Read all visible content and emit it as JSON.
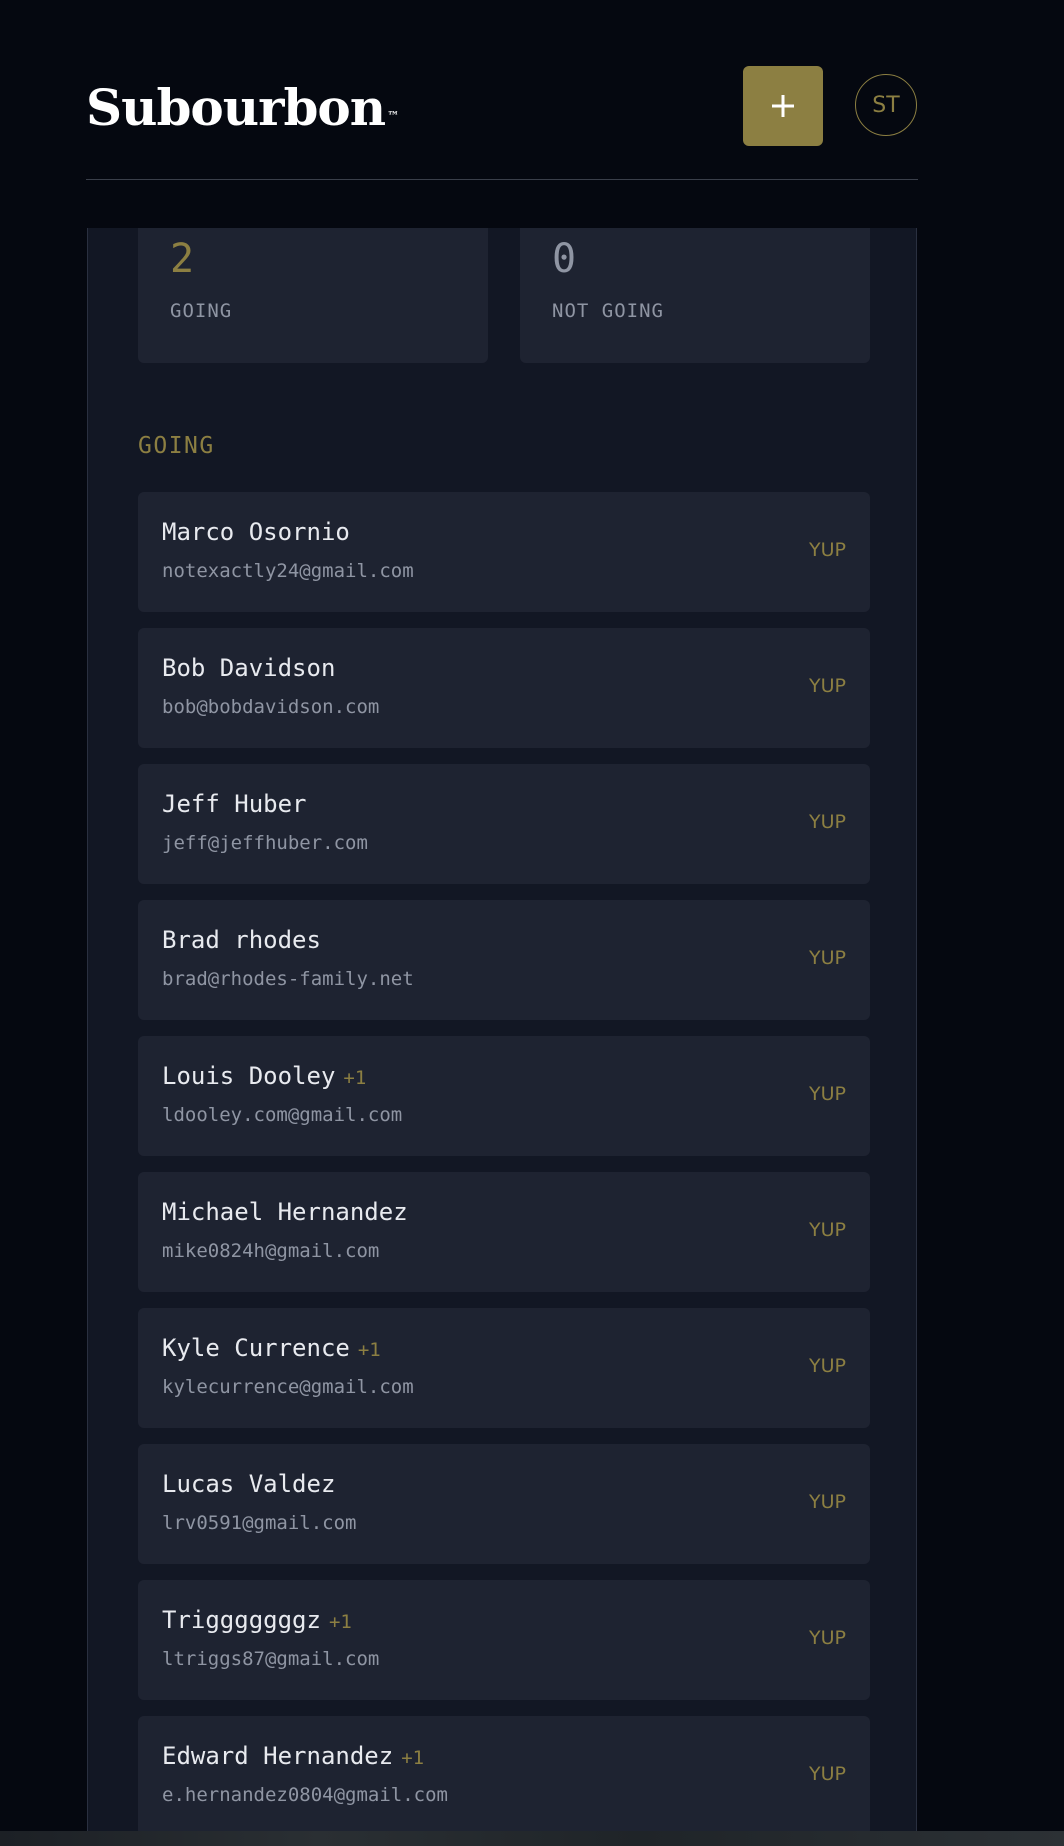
{
  "header": {
    "logo_text": "Subourbon",
    "logo_mark": "™",
    "add_button_icon": "plus-icon",
    "avatar_initials": "ST"
  },
  "stats": {
    "going": {
      "value": "2",
      "label": "GOING"
    },
    "not_going": {
      "value": "0",
      "label": "NOT GOING"
    }
  },
  "section": {
    "heading": "GOING"
  },
  "guests": [
    {
      "name": "Marco Osornio",
      "plus": "",
      "email": "notexactly24@gmail.com",
      "status": "YUP"
    },
    {
      "name": "Bob Davidson",
      "plus": "",
      "email": "bob@bobdavidson.com",
      "status": "YUP"
    },
    {
      "name": "Jeff Huber",
      "plus": "",
      "email": "jeff@jeffhuber.com",
      "status": "YUP"
    },
    {
      "name": "Brad rhodes",
      "plus": "",
      "email": "brad@rhodes-family.net",
      "status": "YUP"
    },
    {
      "name": "Louis Dooley",
      "plus": "+1",
      "email": "ldooley.com@gmail.com",
      "status": "YUP"
    },
    {
      "name": "Michael Hernandez",
      "plus": "",
      "email": "mike0824h@gmail.com",
      "status": "YUP"
    },
    {
      "name": "Kyle Currence",
      "plus": "+1",
      "email": "kylecurrence@gmail.com",
      "status": "YUP"
    },
    {
      "name": "Lucas Valdez",
      "plus": "",
      "email": "lrv0591@gmail.com",
      "status": "YUP"
    },
    {
      "name": "Trigggggggz",
      "plus": "+1",
      "email": "ltriggs87@gmail.com",
      "status": "YUP"
    },
    {
      "name": "Edward Hernandez",
      "plus": "+1",
      "email": "e.hernandez0804@gmail.com",
      "status": "YUP"
    }
  ],
  "colors": {
    "background": "#050810",
    "panel": "#121724",
    "card": "#1e2331",
    "accent": "#8c7f42",
    "text": "#e8eaef",
    "muted": "#8f95a3"
  }
}
